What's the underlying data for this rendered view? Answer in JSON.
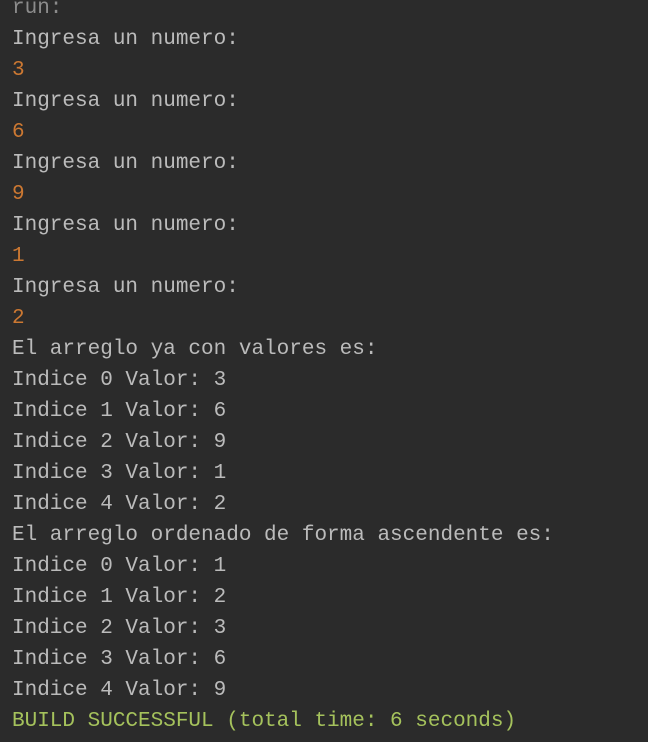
{
  "console": {
    "colors": {
      "background": "#2b2b2b",
      "output": "#bbbbbb",
      "user_input": "#cc7832",
      "run_header": "#8c8c8c",
      "build_success": "#a5c25c"
    },
    "lines": [
      {
        "text": "run:",
        "kind": "header"
      },
      {
        "text": "Ingresa un numero:",
        "kind": "output"
      },
      {
        "text": "3",
        "kind": "input"
      },
      {
        "text": "Ingresa un numero:",
        "kind": "output"
      },
      {
        "text": "6",
        "kind": "input"
      },
      {
        "text": "Ingresa un numero:",
        "kind": "output"
      },
      {
        "text": "9",
        "kind": "input"
      },
      {
        "text": "Ingresa un numero:",
        "kind": "output"
      },
      {
        "text": "1",
        "kind": "input"
      },
      {
        "text": "Ingresa un numero:",
        "kind": "output"
      },
      {
        "text": "2",
        "kind": "input"
      },
      {
        "text": "El arreglo ya con valores es:",
        "kind": "output"
      },
      {
        "text": "Indice 0 Valor: 3",
        "kind": "output"
      },
      {
        "text": "Indice 1 Valor: 6",
        "kind": "output"
      },
      {
        "text": "Indice 2 Valor: 9",
        "kind": "output"
      },
      {
        "text": "Indice 3 Valor: 1",
        "kind": "output"
      },
      {
        "text": "Indice 4 Valor: 2",
        "kind": "output"
      },
      {
        "text": "El arreglo ordenado de forma ascendente es:",
        "kind": "output"
      },
      {
        "text": "Indice 0 Valor: 1",
        "kind": "output"
      },
      {
        "text": "Indice 1 Valor: 2",
        "kind": "output"
      },
      {
        "text": "Indice 2 Valor: 3",
        "kind": "output"
      },
      {
        "text": "Indice 3 Valor: 6",
        "kind": "output"
      },
      {
        "text": "Indice 4 Valor: 9",
        "kind": "output"
      },
      {
        "text": "BUILD SUCCESSFUL (total time: 6 seconds)",
        "kind": "success"
      }
    ]
  }
}
